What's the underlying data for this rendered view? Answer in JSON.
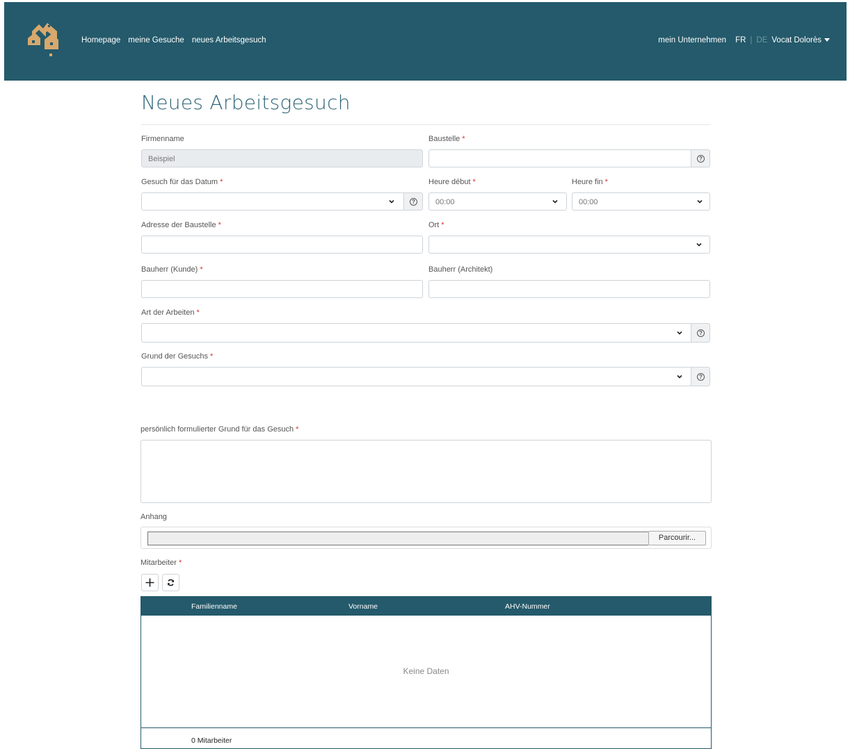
{
  "nav": {
    "links": [
      "Homepage",
      "meine Gesuche",
      "neues Arbeitsgesuch"
    ],
    "company": "mein Unternehmen",
    "lang_fr": "FR",
    "lang_sep": "|",
    "lang_de": "DE",
    "user": "Vocat Dolorès"
  },
  "page": {
    "title": "Neues Arbeitsgesuch"
  },
  "form": {
    "firmenname": {
      "label": "Firmenname",
      "value": "Beispiel"
    },
    "baustelle": {
      "label": "Baustelle",
      "value": ""
    },
    "datum": {
      "label": "Gesuch für das Datum",
      "value": ""
    },
    "heure_debut": {
      "label": "Heure début",
      "value": "00:00"
    },
    "heure_fin": {
      "label": "Heure fin",
      "value": "00:00"
    },
    "adresse": {
      "label": "Adresse der Baustelle",
      "value": ""
    },
    "ort": {
      "label": "Ort",
      "value": ""
    },
    "bauherr_kunde": {
      "label": "Bauherr (Kunde)",
      "value": ""
    },
    "bauherr_architekt": {
      "label": "Bauherr (Architekt)",
      "value": ""
    },
    "art": {
      "label": "Art der Arbeiten",
      "value": ""
    },
    "grund": {
      "label": "Grund der Gesuchs",
      "value": ""
    },
    "grund_text": {
      "label": "persönlich formulierter Grund für das Gesuch",
      "value": ""
    },
    "anhang": {
      "label": "Anhang",
      "button": "Parcourir..."
    },
    "mitarbeiter": {
      "label": "Mitarbeiter",
      "add": "+",
      "refresh": "↻"
    },
    "required_mark": "*",
    "help": "?"
  },
  "grid": {
    "columns": [
      "Familienname",
      "Vorname",
      "AHV-Nummer"
    ],
    "empty_text": "Keine Daten",
    "footer": "0 Mitarbeiter"
  },
  "colors": {
    "primary": "#245a6b",
    "logo": "#d8a86c",
    "required": "#d9302e"
  },
  "icons": {
    "dropdown": "chevron-down-icon",
    "help": "help-circle-icon",
    "add": "plus-icon",
    "refresh": "refresh-icon"
  }
}
